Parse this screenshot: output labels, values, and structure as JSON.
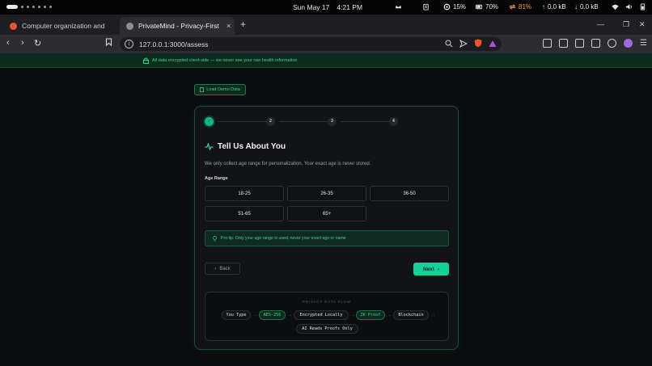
{
  "os": {
    "date": "Sun May 17",
    "time": "4:21 PM",
    "cpu": "15%",
    "battery_status": "70%",
    "sync": "81%",
    "net_up": "0.0 kB",
    "net_down": "0.0 kB"
  },
  "browser": {
    "tabs": [
      {
        "title": "Computer organization and a"
      },
      {
        "title": "PrivateMind - Privacy-First",
        "close": "×"
      }
    ],
    "new_tab": "+",
    "url": "127.0.0.1:3000/assess"
  },
  "banner": {
    "text": "All data encrypted client-side — we never see your raw health information"
  },
  "demo_button": "Load Demo Data",
  "steps": [
    {
      "label": "✓",
      "state": "active"
    },
    {
      "label": "2"
    },
    {
      "label": "3"
    },
    {
      "label": "4"
    }
  ],
  "form": {
    "title": "Tell Us About You",
    "subtitle": "We only collect age range for personalization. Your exact age is never stored.",
    "field_label": "Age Range",
    "options": [
      "18-25",
      "26-35",
      "36-50",
      "51-65",
      "65+"
    ],
    "tip": "Pro tip: Only your age range is used, never your exact age or name",
    "back": "Back",
    "next": "Next"
  },
  "flow": {
    "title": "PRIVACY DATA FLOW",
    "items": [
      "You Type",
      "AES-256",
      "Encrypted Locally",
      "ZK Proof",
      "Blockchain",
      "AI Reads Proofs Only"
    ]
  },
  "colors": {
    "accent": "#10d39a",
    "accent_text": "#39d399",
    "card_border": "#1c4d38",
    "page_bg": "#0b0c0e"
  }
}
